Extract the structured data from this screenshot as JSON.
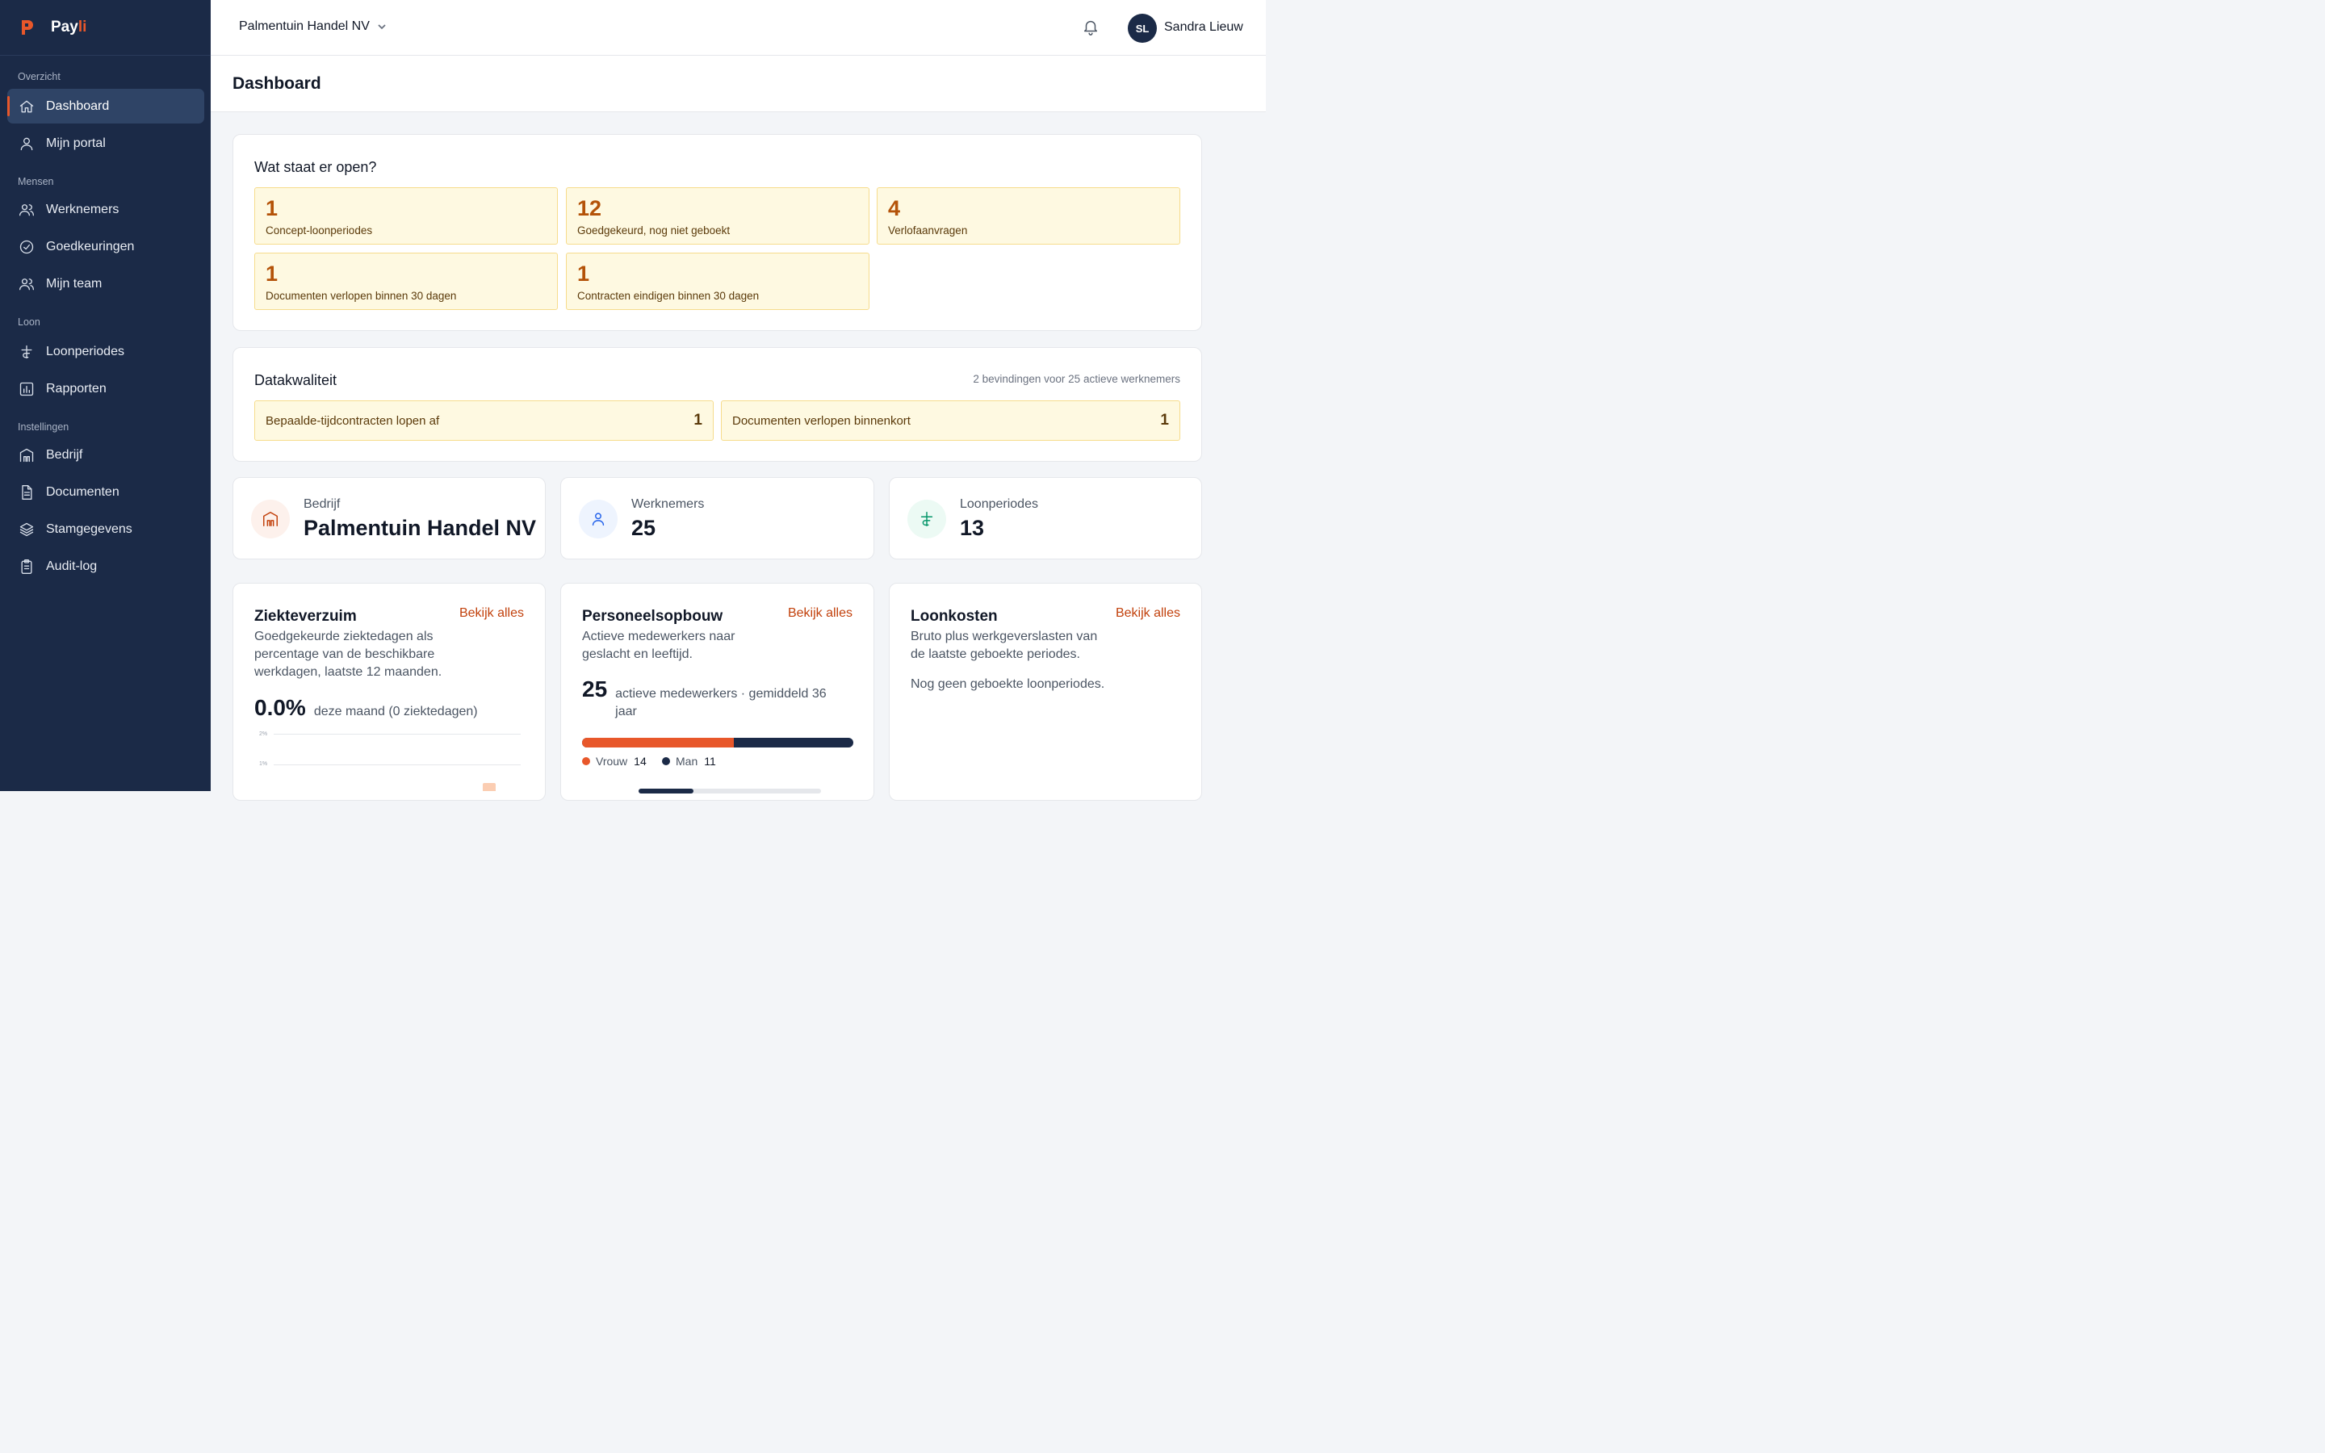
{
  "brand": {
    "name_main": "Pay",
    "name_accent": "li"
  },
  "sidebar": {
    "sections": [
      {
        "label": "Overzicht"
      },
      {
        "label": "Mensen"
      },
      {
        "label": "Loon"
      },
      {
        "label": "Instellingen"
      }
    ],
    "items": [
      {
        "label": "Dashboard",
        "icon": "home-icon",
        "active": true
      },
      {
        "label": "Mijn portal",
        "icon": "user-icon"
      },
      {
        "label": "Werknemers",
        "icon": "users-icon"
      },
      {
        "label": "Goedkeuringen",
        "icon": "check-circle-icon"
      },
      {
        "label": "Mijn team",
        "icon": "team-icon"
      },
      {
        "label": "Loonperiodes",
        "icon": "florin-icon"
      },
      {
        "label": "Rapporten",
        "icon": "bar-chart-icon"
      },
      {
        "label": "Bedrijf",
        "icon": "building-icon"
      },
      {
        "label": "Documenten",
        "icon": "document-icon"
      },
      {
        "label": "Stamgegevens",
        "icon": "layers-icon"
      },
      {
        "label": "Audit-log",
        "icon": "clipboard-icon"
      }
    ]
  },
  "topbar": {
    "company": "Palmentuin Handel NV",
    "user_initials": "SL",
    "user_name": "Sandra Lieuw"
  },
  "page": {
    "title": "Dashboard"
  },
  "open_items": {
    "title": "Wat staat er open?",
    "tiles": [
      {
        "count": "1",
        "label": "Concept-loonperiodes"
      },
      {
        "count": "12",
        "label": "Goedgekeurd, nog niet geboekt"
      },
      {
        "count": "4",
        "label": "Verlofaanvragen"
      },
      {
        "count": "1",
        "label": "Documenten verlopen binnen 30 dagen"
      },
      {
        "count": "1",
        "label": "Contracten eindigen binnen 30 dagen"
      }
    ]
  },
  "data_quality": {
    "title": "Datakwaliteit",
    "meta": "2 bevindingen voor 25 actieve werknemers",
    "items": [
      {
        "label": "Bepaalde-tijdcontracten lopen af",
        "count": "1"
      },
      {
        "label": "Documenten verlopen binnenkort",
        "count": "1"
      }
    ]
  },
  "stats": [
    {
      "label": "Bedrijf",
      "value": "Palmentuin Handel NV",
      "icon": "building-icon",
      "color": "#c2410c"
    },
    {
      "label": "Werknemers",
      "value": "25",
      "icon": "user-icon",
      "color": "#2563eb"
    },
    {
      "label": "Loonperiodes",
      "value": "13",
      "icon": "florin-icon",
      "color": "#059669"
    }
  ],
  "widgets": {
    "sick": {
      "title": "Ziekteverzuim",
      "link": "Bekijk alles",
      "description": "Goedgekeurde ziektedagen als percentage van de beschikbare werkdagen, laatste 12 maanden.",
      "value": "0.0%",
      "value_note": "deze maand (0 ziektedagen)",
      "ticks": [
        "2%",
        "1%"
      ]
    },
    "headcount": {
      "title": "Personeelsopbouw",
      "link": "Bekijk alles",
      "description": "Actieve medewerkers naar geslacht en leeftijd.",
      "value": "25",
      "value_note": "actieve medewerkers · gemiddeld 36 jaar",
      "female_label": "Vrouw",
      "female_count": 14,
      "male_label": "Man",
      "male_count": 11,
      "female_color": "#e8572a",
      "male_color": "#1b2a47"
    },
    "payroll": {
      "title": "Loonkosten",
      "link": "Bekijk alles",
      "description": "Bruto plus werkgeverslasten van de laatste geboekte periodes.",
      "empty": "Nog geen geboekte loonperiodes."
    }
  }
}
